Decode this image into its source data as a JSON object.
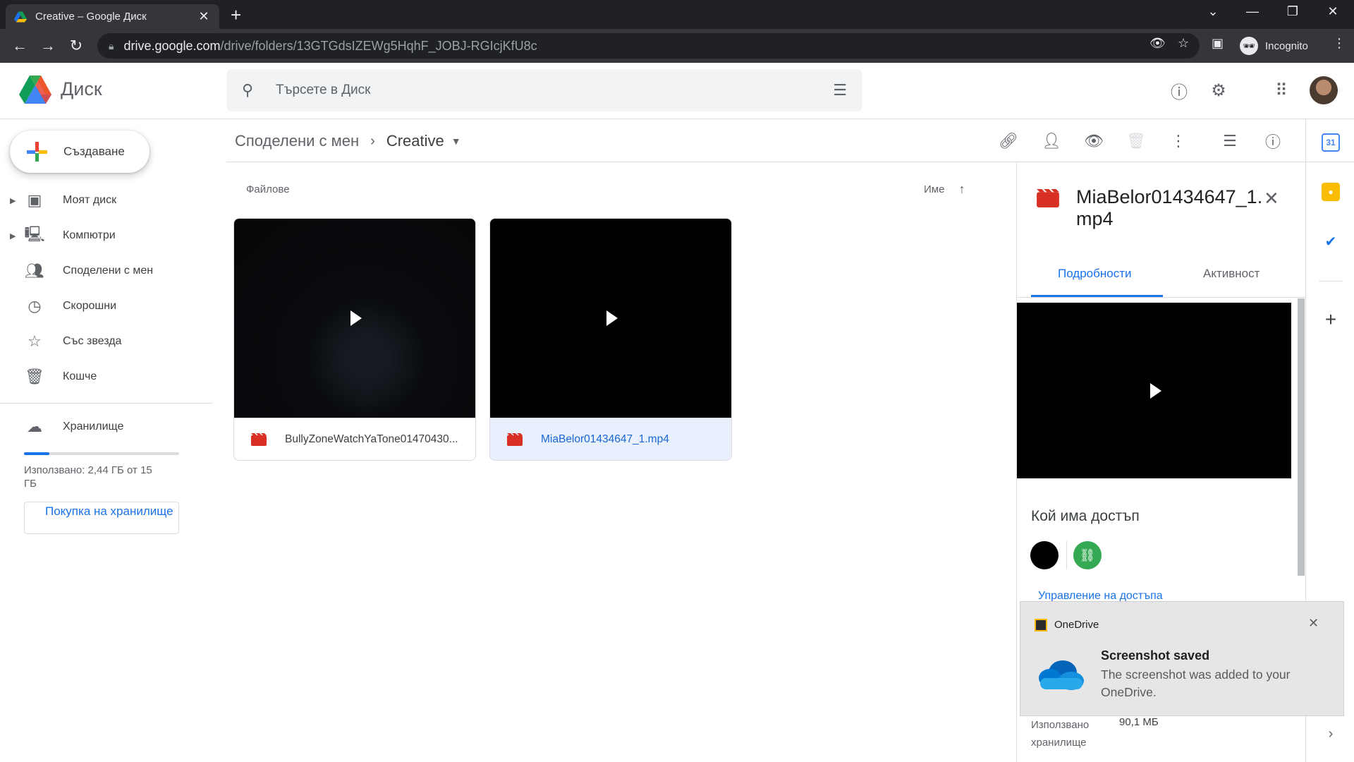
{
  "browser": {
    "tab_title": "Creative – Google Диск",
    "url_host": "drive.google.com",
    "url_path": "/drive/folders/13GTGdsIZEWg5HqhF_JOBJ-RGIcjKfU8c",
    "incognito_label": "Incognito"
  },
  "header": {
    "app_name": "Диск",
    "search_placeholder": "Търсете в Диск"
  },
  "sidebar": {
    "create_label": "Създаване",
    "items": [
      {
        "label": "Моят диск",
        "icon": "my-drive-icon",
        "expandable": true
      },
      {
        "label": "Компютри",
        "icon": "computers-icon",
        "expandable": true
      },
      {
        "label": "Споделени с мен",
        "icon": "shared-icon",
        "expandable": false
      },
      {
        "label": "Скорошни",
        "icon": "clock-icon",
        "expandable": false
      },
      {
        "label": "Със звезда",
        "icon": "star-icon",
        "expandable": false
      },
      {
        "label": "Кошче",
        "icon": "trash-icon",
        "expandable": false
      }
    ],
    "storage_label": "Хранилище",
    "storage_used_fraction": 0.163,
    "storage_text": "Използвано: 2,44 ГБ от 15 ГБ",
    "buy_storage_label": "Покупка на хранилище"
  },
  "breadcrumb": {
    "parent": "Споделени с мен",
    "current": "Creative"
  },
  "main": {
    "section_label": "Файлове",
    "sort_label": "Име",
    "files": [
      {
        "name": "BullyZoneWatchYaTone01470430...",
        "selected": false
      },
      {
        "name": "MiaBelor01434647_1.mp4",
        "selected": true
      }
    ]
  },
  "details": {
    "file_title": "MiaBelor01434647_1.mp4",
    "tab_details": "Подробности",
    "tab_activity": "Активност",
    "access_title": "Кой има достъп",
    "manage_access": "Управление на достъпа",
    "used_storage_label": "Използвано хранилище",
    "used_storage_value": "90,1 МБ"
  },
  "side_panel": {
    "calendar_day": "31"
  },
  "toast": {
    "app": "OneDrive",
    "title": "Screenshot saved",
    "body": "The screenshot was added to your OneDrive."
  },
  "colors": {
    "accent": "#1a73e8",
    "selected_bg": "#e8f0fe",
    "video_red": "#d93025"
  }
}
